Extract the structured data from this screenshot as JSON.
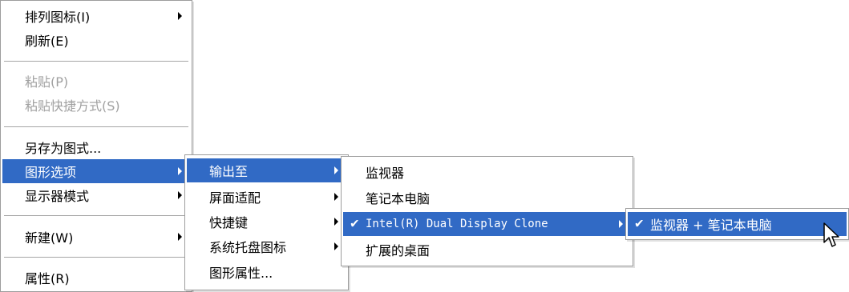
{
  "main_menu": {
    "arrange_icons": "排列图标(I)",
    "refresh": "刷新(E)",
    "paste": "粘贴(P)",
    "paste_shortcut": "粘贴快捷方式(S)",
    "save_as_scheme": "另存为图式...",
    "graphics_options": "图形选项",
    "display_modes": "显示器模式",
    "new": "新建(W)",
    "properties": "属性(R)"
  },
  "graphics_submenu": {
    "output_to": "输出至",
    "panel_fit": "屏面适配",
    "hotkeys": "快捷键",
    "tray_icon": "系统托盘图标",
    "graphics_properties": "图形属性..."
  },
  "output_submenu": {
    "monitor": "监视器",
    "notebook": "笔记本电脑",
    "dual_display_clone": "Intel(R) Dual Display Clone",
    "extended_desktop": "扩展的桌面"
  },
  "clone_submenu": {
    "monitor_plus_notebook": "监视器 + 笔记本电脑"
  },
  "icons": {
    "check": "✔",
    "submenu_arrow": "triangle-right"
  },
  "colors": {
    "highlight": "#316ac5",
    "disabled_text": "#a0a0a0"
  }
}
